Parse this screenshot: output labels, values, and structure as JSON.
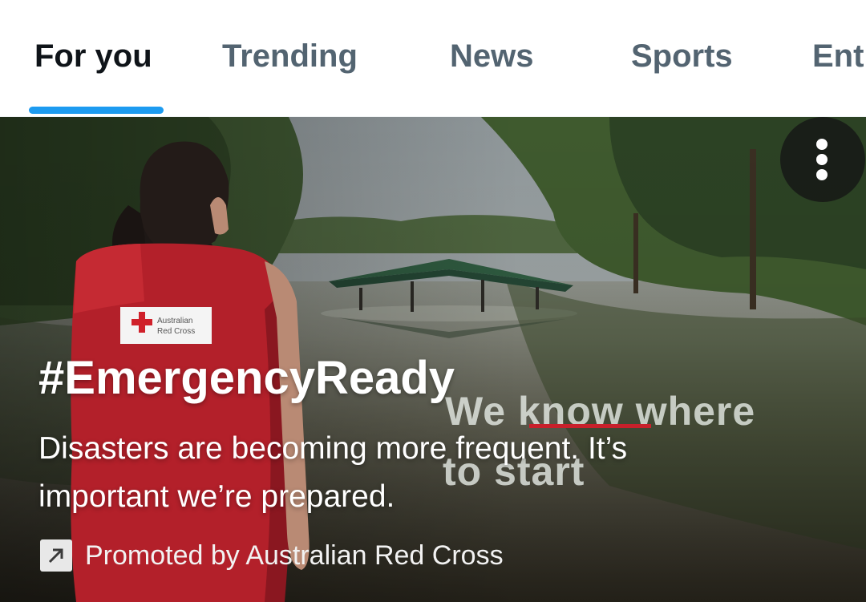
{
  "tabs": [
    {
      "label": "For you",
      "active": true
    },
    {
      "label": "Trending",
      "active": false
    },
    {
      "label": "News",
      "active": false
    },
    {
      "label": "Sports",
      "active": false
    },
    {
      "label": "Ent",
      "active": false
    }
  ],
  "colors": {
    "accent": "#1d9bf0",
    "active_tab_text": "#0f1419",
    "inactive_tab_text": "#536471",
    "red_cross_red": "#d0202a"
  },
  "hero": {
    "vest_logo_line1": "Australian",
    "vest_logo_line2": "Red Cross",
    "video_overlay_line1_a": "We ",
    "video_overlay_line1_b": "know",
    "video_overlay_line1_c": " where",
    "video_overlay_line2": "to start",
    "title": "#EmergencyReady",
    "description": "Disasters are becoming more frequent. It’s important we’re prepared.",
    "promoted_text": "Promoted by Australian Red Cross",
    "promoted_icon": "arrow-up-right-icon",
    "menu_icon": "more-vertical-icon"
  }
}
